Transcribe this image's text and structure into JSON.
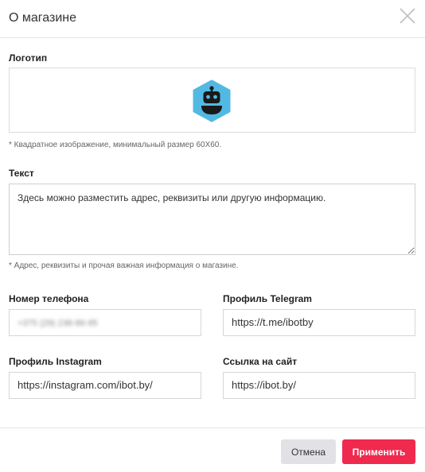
{
  "dialog": {
    "title": "О магазине"
  },
  "logo": {
    "label": "Логотип",
    "hint": "* Квадратное изображение, минимальный размер 60Х60.",
    "colors": {
      "hex": "#52b9e3",
      "face": "#1a1a1a"
    }
  },
  "text": {
    "label": "Текст",
    "value": "Здесь можно разместить адрес, реквизиты или другую информацию.",
    "hint": "* Адрес, реквизиты и прочая важная информация о магазине."
  },
  "phone": {
    "label": "Номер телефона",
    "value": "+375 (29) 238-86-95"
  },
  "telegram": {
    "label": "Профиль Telegram",
    "value": "https://t.me/ibotby"
  },
  "instagram": {
    "label": "Профиль Instagram",
    "value": "https://instagram.com/ibot.by/"
  },
  "site": {
    "label": "Ссылка на сайт",
    "value": "https://ibot.by/"
  },
  "buttons": {
    "cancel": "Отмена",
    "apply": "Применить"
  },
  "colors": {
    "accent": "#f0294f",
    "cancel_bg": "#e2e2e6"
  }
}
